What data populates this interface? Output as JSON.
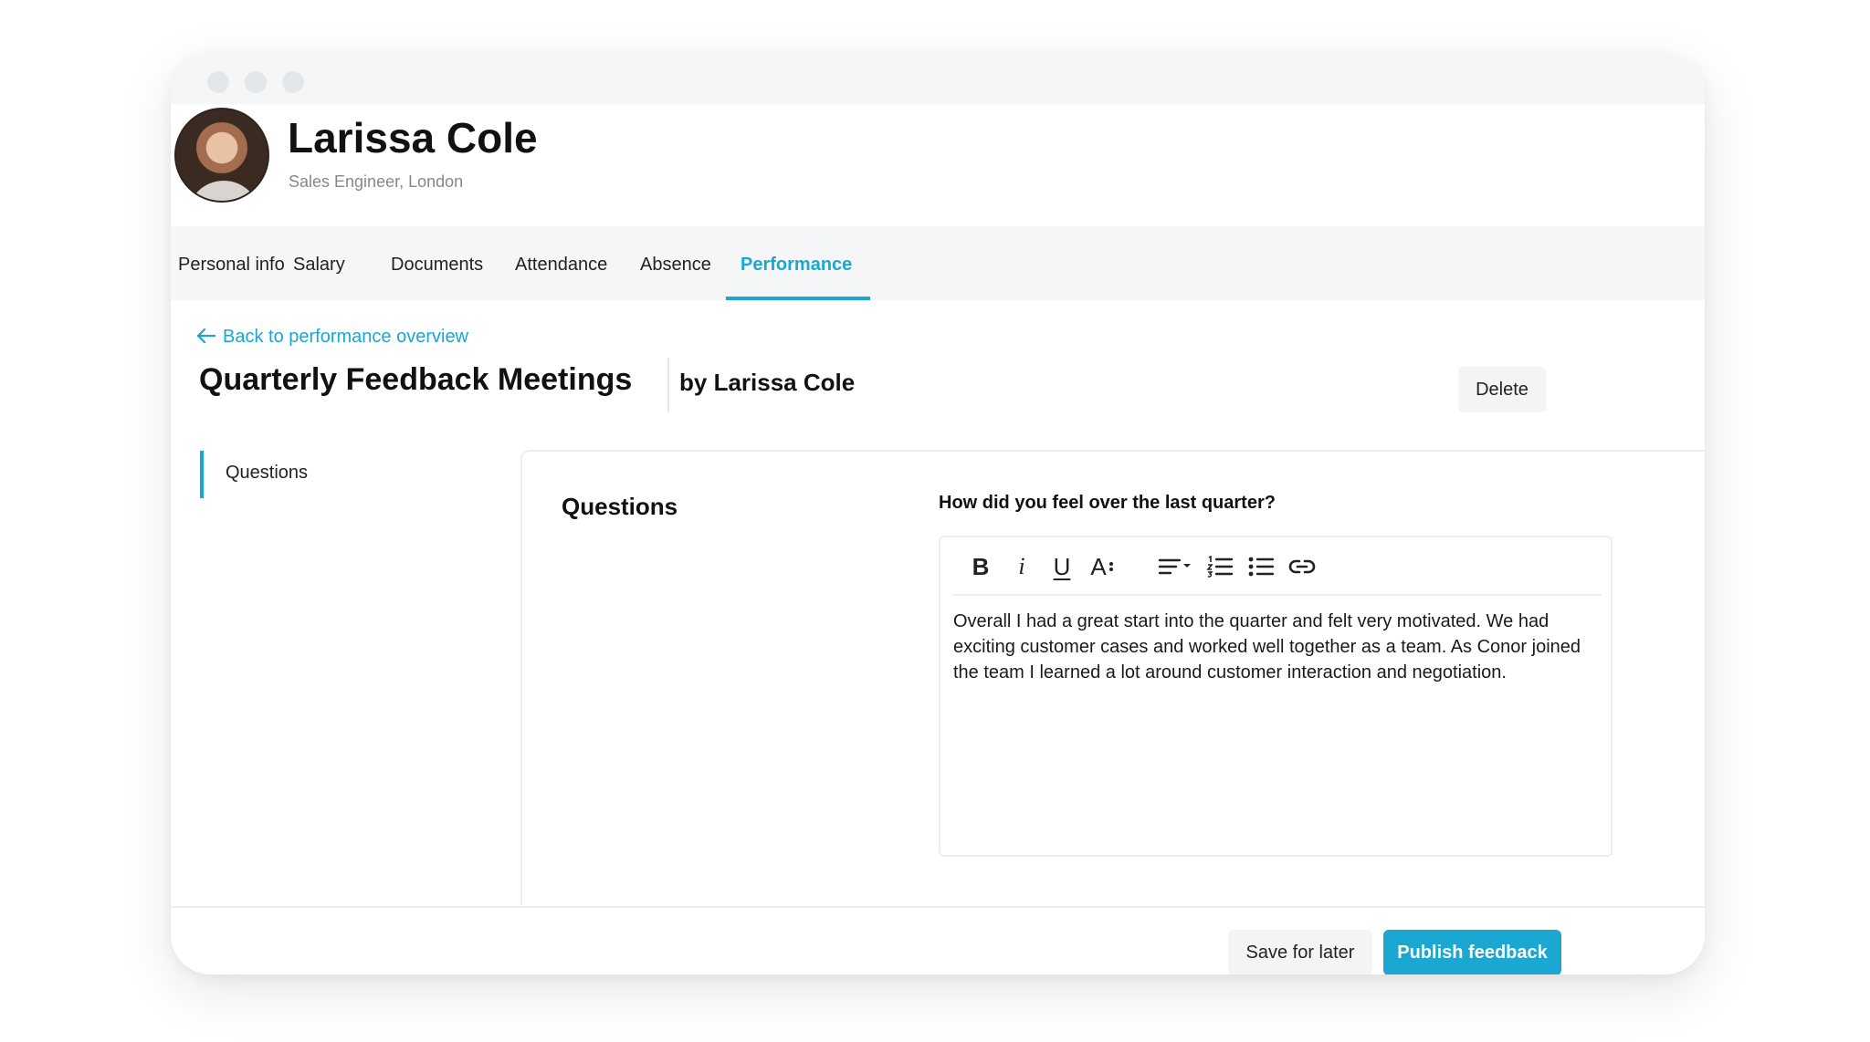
{
  "profile": {
    "name": "Larissa Cole",
    "role": "Sales Engineer, London"
  },
  "tabs": [
    {
      "label": "Personal info"
    },
    {
      "label": "Salary"
    },
    {
      "label": "Documents"
    },
    {
      "label": "Attendance"
    },
    {
      "label": "Absence"
    },
    {
      "label": "Performance",
      "active": true
    }
  ],
  "page": {
    "back_label": "Back to performance overview",
    "title": "Quarterly Feedback Meetings",
    "author": "by Larissa Cole",
    "delete_label": "Delete"
  },
  "side_nav": {
    "items": [
      {
        "label": "Questions"
      }
    ]
  },
  "card": {
    "heading": "Questions",
    "question": "How did you feel over the last quarter?",
    "answer": "Overall I had a great start into the quarter and felt very motivated. We had exciting customer cases and worked well together as a team. As Conor joined the team I learned a lot around customer interaction and negotiation."
  },
  "toolbar": {
    "bold_glyph": "B",
    "italic_glyph": "i",
    "underline_glyph": "U",
    "font_size_glyph": "A",
    "icons": [
      "bold-icon",
      "italic-icon",
      "underline-icon",
      "font-size-icon",
      "align-icon",
      "numbered-list-icon",
      "bulleted-list-icon",
      "link-icon"
    ]
  },
  "footer": {
    "save_label": "Save for later",
    "publish_label": "Publish feedback"
  },
  "colors": {
    "accent": "#1aa7d2",
    "panel_bg": "#f4f6f7",
    "border": "#eceef0"
  }
}
